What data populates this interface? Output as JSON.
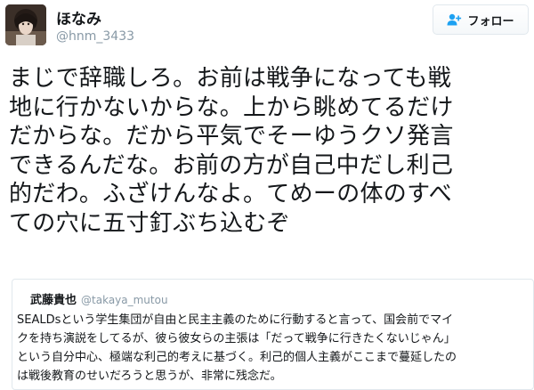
{
  "tweet": {
    "display_name": "ほなみ",
    "handle": "@hnm_3433",
    "follow_label": "フォロー",
    "follow_icon": "add-user-icon",
    "text_lines": [
      "まじで辞職しろ。お前は戦争になっても戦",
      "地に行かないからな。上から眺めてるだけ",
      "だからな。だから平気でそーゆうクソ発言",
      "できるんだな。お前の方が自己中だし利己",
      "的だわ。ふざけんなよ。てめーの体のすべ",
      "ての穴に五寸釘ぶち込むぞ"
    ]
  },
  "quoted": {
    "display_name": "武藤貴也",
    "handle": "@takaya_mutou",
    "text_lines": [
      "SEALDsという学生集団が自由と民主主義のために行動すると言って、国会前でマイ",
      "クを持ち演説をしてるが、彼ら彼女らの主張は「だって戦争に行きたくないじゃん」",
      "という自分中心、極端な利己的考えに基づく。利己的個人主義がここまで蔓延したの",
      "は戦後教育のせいだろうと思うが、非常に残念だ。"
    ]
  },
  "colors": {
    "text": "#14171a",
    "muted": "#8899a6",
    "border": "#e1e8ed",
    "accent": "#1da1f2"
  }
}
